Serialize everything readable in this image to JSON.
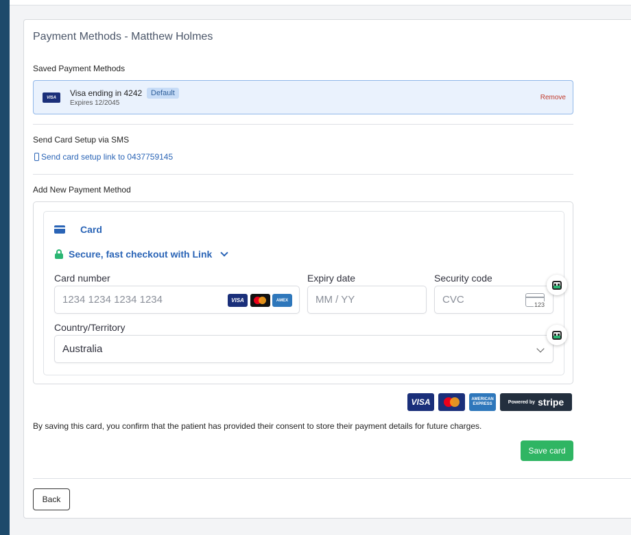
{
  "page": {
    "title": "Payment Methods - Matthew Holmes"
  },
  "saved": {
    "section_label": "Saved Payment Methods",
    "card": {
      "brand": "VISA",
      "name": "Visa ending in 4242",
      "badge": "Default",
      "expires": "Expires 12/2045",
      "remove_label": "Remove"
    }
  },
  "sms": {
    "section_label": "Send Card Setup via SMS",
    "link_label": "Send card setup link to 0437759145",
    "icon": "phone-icon"
  },
  "add_new": {
    "section_label": "Add New Payment Method",
    "tab_label": "Card",
    "link_checkout_label": "Secure, fast checkout with Link",
    "card_number": {
      "label": "Card number",
      "placeholder": "1234 1234 1234 1234",
      "brands": [
        "VISA",
        "mastercard",
        "AMEX"
      ]
    },
    "expiry": {
      "label": "Expiry date",
      "placeholder": "MM / YY"
    },
    "security": {
      "label": "Security code",
      "placeholder": "CVC",
      "icon_text": "123"
    },
    "country": {
      "label": "Country/Territory",
      "value": "Australia"
    }
  },
  "footer_logos": {
    "visa": "VISA",
    "amex": "AMERICAN EXPRESS",
    "stripe_prefix": "Powered by",
    "stripe_brand": "stripe"
  },
  "consent_text": "By saving this card, you confirm that the patient has provided their consent to store their payment details for future charges.",
  "buttons": {
    "save": "Save card",
    "back": "Back"
  },
  "colors": {
    "accent": "#2a64b6",
    "success": "#2fb563",
    "danger": "#c0392b",
    "sidebar": "#1d4a6b"
  }
}
